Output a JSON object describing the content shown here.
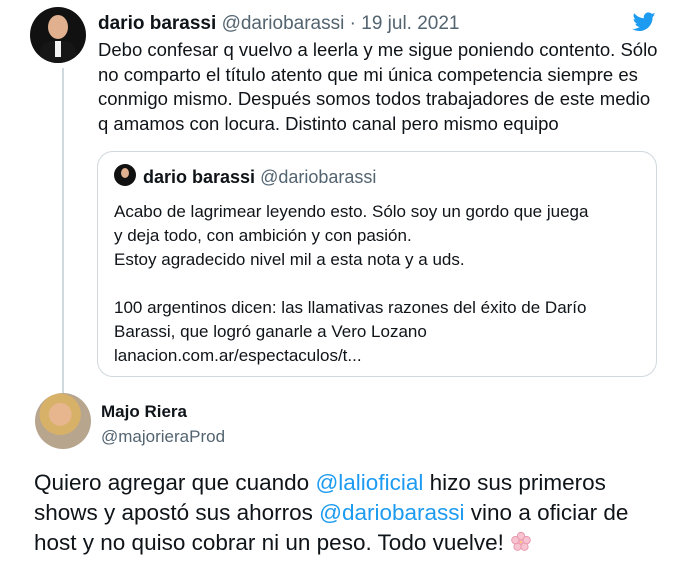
{
  "tweet": {
    "name": "dario barassi",
    "handle": "@dariobarassi",
    "separator": "·",
    "date": "19 jul. 2021",
    "body": "Debo confesar q vuelvo a leerla y me sigue poniendo contento. Sólo no comparto el título atento que mi única competencia siempre es conmigo mismo. Después somos todos trabajadores de este medio q amamos con locura. Distinto canal pero mismo equipo",
    "brand_icon": "twitter-bird-icon",
    "brand_color": "#1d9bf0"
  },
  "quote": {
    "name": "dario barassi",
    "handle": "@dariobarassi",
    "lines": [
      "Acabo de lagrimear leyendo esto. Sólo soy un gordo que juega",
      "y deja todo, con ambición y con pasión.",
      "Estoy agradecido nivel mil a esta nota y a uds.",
      "",
      "100 argentinos dicen: las llamativas razones del éxito de Darío",
      "Barassi, que logró ganarle a Vero Lozano",
      "lanacion.com.ar/espectaculos/t..."
    ]
  },
  "reply": {
    "name": "Majo Riera",
    "handle": "@majorieraProd",
    "line1_a": "Quiero agregar que cuando ",
    "mention1": "@lalioficial",
    "line1_b": " hizo sus primeros",
    "line2_a": "shows y apostó sus ahorros ",
    "mention2": "@dariobarassi",
    "line2_b": " vino a oficiar de",
    "line3": "host y no quiso cobrar ni un peso. Todo vuelve! ",
    "emoji_icon": "cherry-blossom-icon",
    "mention_color": "#1d9bf0"
  }
}
